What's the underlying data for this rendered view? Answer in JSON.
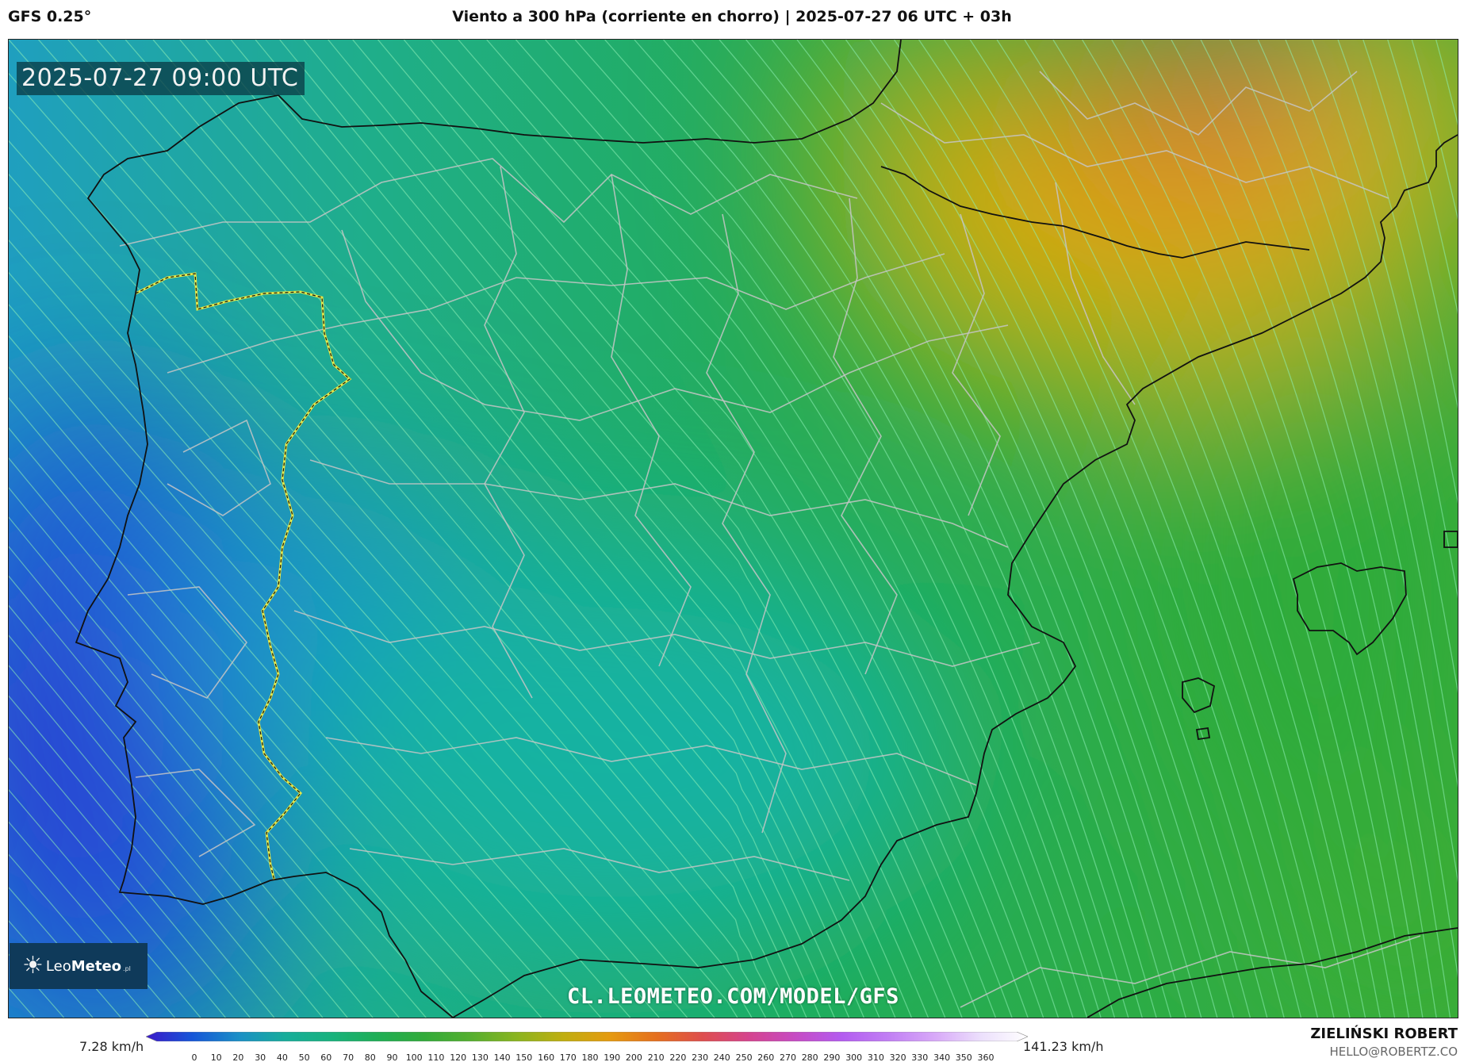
{
  "header": {
    "model": "GFS 0.25°",
    "title": "Viento a 300 hPa (corriente en chorro) | 2025-07-27 06 UTC + 03h"
  },
  "map": {
    "timestamp": "2025-07-27 09:00 UTC",
    "watermark": "CL.LEOMETEO.COM/MODEL/GFS",
    "logo": {
      "prefix": "Leo",
      "name": "Meteo",
      "suffix": ".pl"
    }
  },
  "legend": {
    "min_label": "7.28 km/h",
    "max_label": "141.23 km/h",
    "unit": "km/h",
    "ticks": [
      "0",
      "10",
      "20",
      "30",
      "40",
      "50",
      "60",
      "70",
      "80",
      "90",
      "100",
      "110",
      "120",
      "130",
      "140",
      "150",
      "160",
      "170",
      "180",
      "190",
      "200",
      "210",
      "220",
      "230",
      "240",
      "250",
      "260",
      "270",
      "280",
      "290",
      "300",
      "310",
      "320",
      "330",
      "340",
      "350",
      "360"
    ],
    "colors": [
      "#3b19c9",
      "#1656d8",
      "#1a8fc6",
      "#17ad9b",
      "#18b27d",
      "#1fae55",
      "#32ab3a",
      "#55af2f",
      "#8bb41f",
      "#c0ae10",
      "#e59a10",
      "#e56f1e",
      "#de4e4e",
      "#d5448f",
      "#c64bc4",
      "#b35cf0",
      "#c17ff4",
      "#d8a9f8",
      "#ece0fc",
      "#ffffff"
    ]
  },
  "footer": {
    "author": "ZIELIŃSKI ROBERT",
    "email": "HELLO@ROBERTZ.CO"
  },
  "field_colors": {
    "ocean_atlantic": "#1f63d6",
    "low_core": "#2a3ad8",
    "teal": "#17b0a0",
    "green": "#23ac48",
    "yellow": "#cbb012",
    "orange": "#e38a1c",
    "red": "#df5152",
    "coastline": "#111111",
    "admin_borders": "#bdbdbd",
    "portugal_border": "#d8e040"
  }
}
